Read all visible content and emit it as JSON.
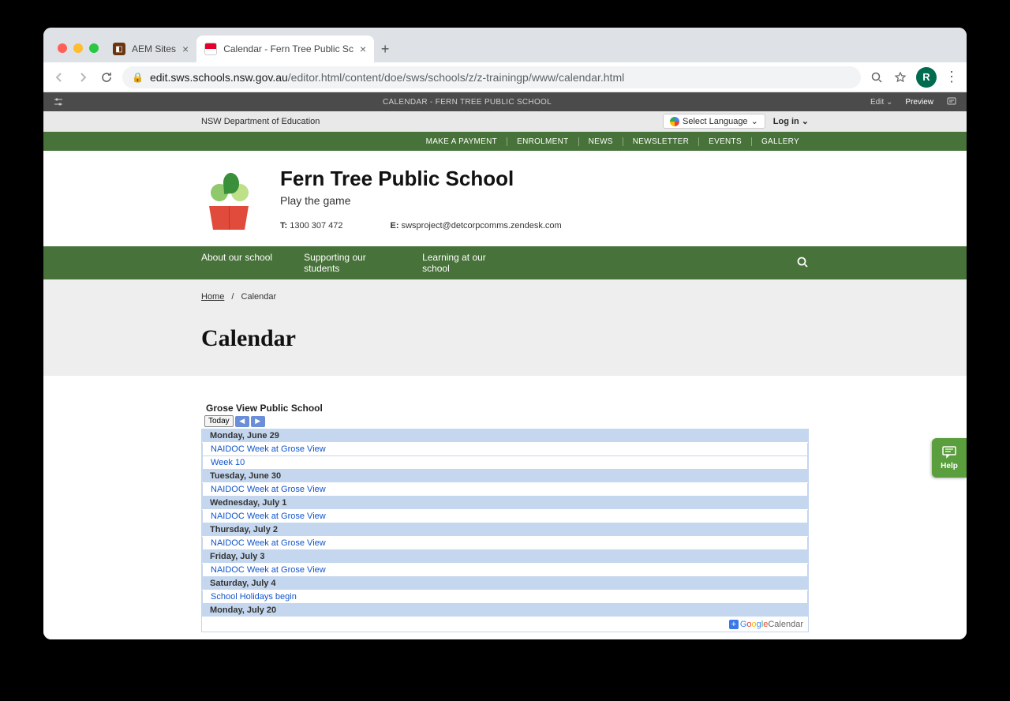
{
  "browser": {
    "tabs": [
      {
        "title": "AEM Sites",
        "active": false
      },
      {
        "title": "Calendar - Fern Tree Public Sc",
        "active": true
      }
    ],
    "url_domain": "edit.sws.schools.nsw.gov.au",
    "url_path": "/editor.html/content/doe/sws/schools/z/z-trainingp/www/calendar.html",
    "avatar_letter": "R"
  },
  "aem": {
    "title": "CALENDAR - FERN TREE PUBLIC SCHOOL",
    "edit": "Edit",
    "preview": "Preview"
  },
  "topstrip": {
    "dept": "NSW Department of Education",
    "lang": "Select Language",
    "login": "Log in"
  },
  "quicklinks": [
    "MAKE A PAYMENT",
    "ENROLMENT",
    "NEWS",
    "NEWSLETTER",
    "EVENTS",
    "GALLERY"
  ],
  "school": {
    "name": "Fern Tree Public School",
    "motto": "Play the game",
    "phone_label": "T:",
    "phone": "1300 307 472",
    "email_label": "E:",
    "email": "swsproject@detcorpcomms.zendesk.com"
  },
  "mainnav": [
    "About our school",
    "Supporting our students",
    "Learning at our school"
  ],
  "breadcrumb": {
    "home": "Home",
    "current": "Calendar"
  },
  "page_title": "Calendar",
  "calendar": {
    "source_title": "Grose View Public School",
    "today": "Today",
    "days": [
      {
        "label": "Monday, June 29",
        "events": [
          "NAIDOC Week at Grose View",
          "Week 10"
        ]
      },
      {
        "label": "Tuesday, June 30",
        "events": [
          "NAIDOC Week at Grose View"
        ]
      },
      {
        "label": "Wednesday, July 1",
        "events": [
          "NAIDOC Week at Grose View"
        ]
      },
      {
        "label": "Thursday, July 2",
        "events": [
          "NAIDOC Week at Grose View"
        ]
      },
      {
        "label": "Friday, July 3",
        "events": [
          "NAIDOC Week at Grose View"
        ]
      },
      {
        "label": "Saturday, July 4",
        "events": [
          "School Holidays begin"
        ]
      },
      {
        "label": "Monday, July 20",
        "events": []
      }
    ],
    "footer_brand": "GoogleCalendar"
  },
  "help": "Help"
}
